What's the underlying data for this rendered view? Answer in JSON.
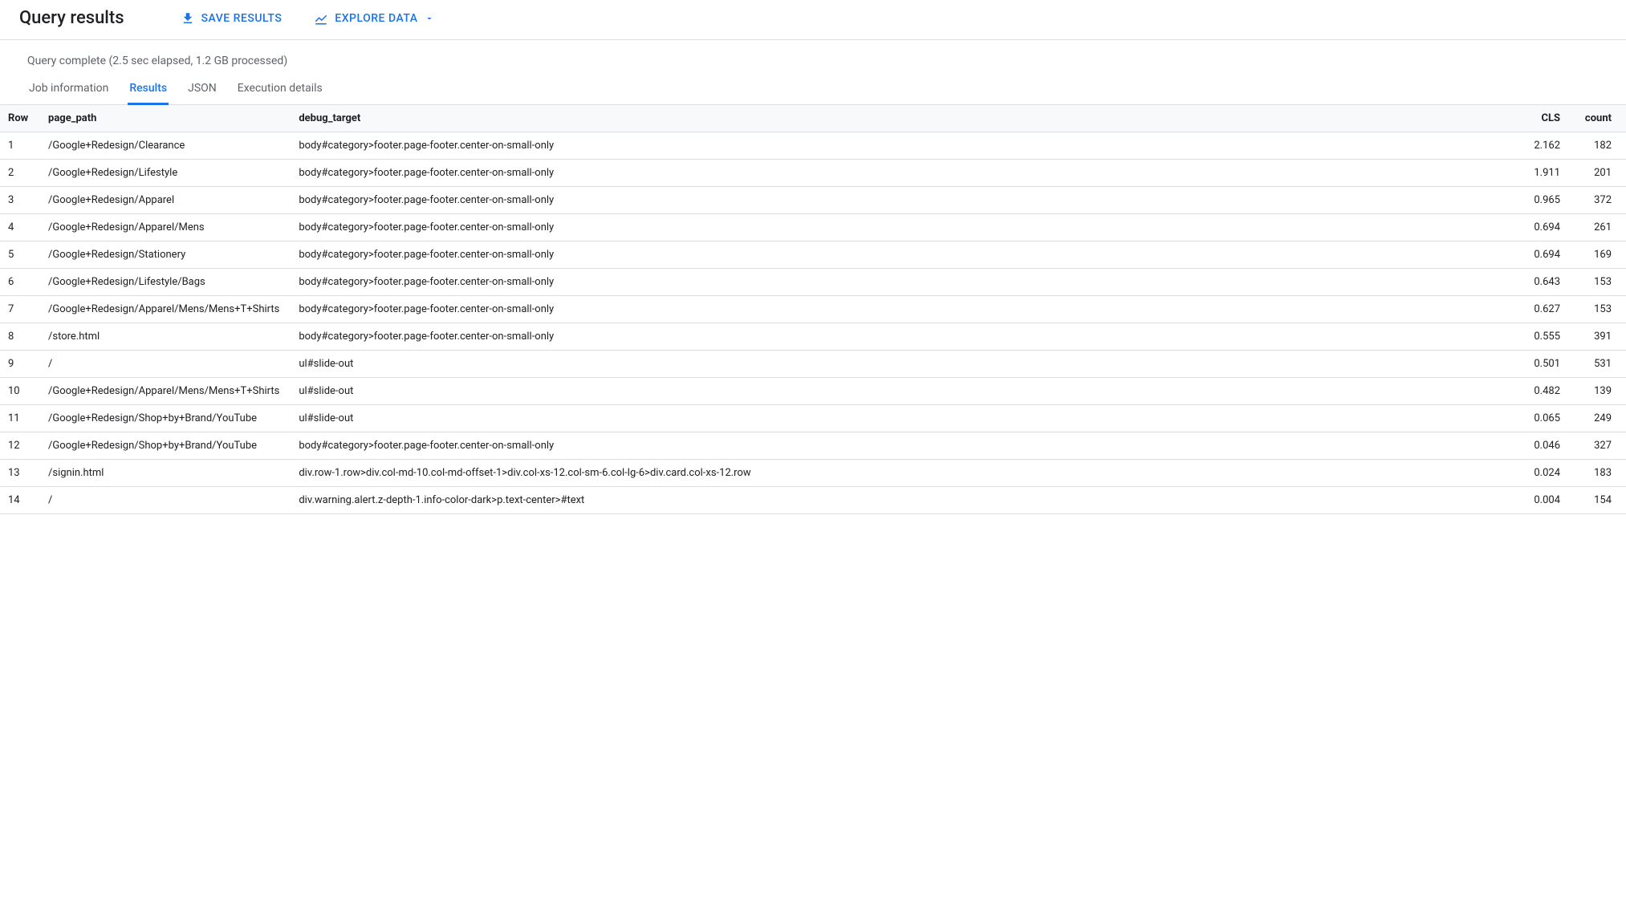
{
  "header": {
    "title": "Query results",
    "save_label": "SAVE RESULTS",
    "explore_label": "EXPLORE DATA"
  },
  "status": "Query complete (2.5 sec elapsed, 1.2 GB processed)",
  "tabs": {
    "job": "Job information",
    "results": "Results",
    "json": "JSON",
    "exec": "Execution details"
  },
  "columns": {
    "row": "Row",
    "page_path": "page_path",
    "debug_target": "debug_target",
    "cls": "CLS",
    "count": "count"
  },
  "rows": [
    {
      "n": "1",
      "page_path": "/Google+Redesign/Clearance",
      "debug_target": "body#category>footer.page-footer.center-on-small-only",
      "cls": "2.162",
      "count": "182"
    },
    {
      "n": "2",
      "page_path": "/Google+Redesign/Lifestyle",
      "debug_target": "body#category>footer.page-footer.center-on-small-only",
      "cls": "1.911",
      "count": "201"
    },
    {
      "n": "3",
      "page_path": "/Google+Redesign/Apparel",
      "debug_target": "body#category>footer.page-footer.center-on-small-only",
      "cls": "0.965",
      "count": "372"
    },
    {
      "n": "4",
      "page_path": "/Google+Redesign/Apparel/Mens",
      "debug_target": "body#category>footer.page-footer.center-on-small-only",
      "cls": "0.694",
      "count": "261"
    },
    {
      "n": "5",
      "page_path": "/Google+Redesign/Stationery",
      "debug_target": "body#category>footer.page-footer.center-on-small-only",
      "cls": "0.694",
      "count": "169"
    },
    {
      "n": "6",
      "page_path": "/Google+Redesign/Lifestyle/Bags",
      "debug_target": "body#category>footer.page-footer.center-on-small-only",
      "cls": "0.643",
      "count": "153"
    },
    {
      "n": "7",
      "page_path": "/Google+Redesign/Apparel/Mens/Mens+T+Shirts",
      "debug_target": "body#category>footer.page-footer.center-on-small-only",
      "cls": "0.627",
      "count": "153"
    },
    {
      "n": "8",
      "page_path": "/store.html",
      "debug_target": "body#category>footer.page-footer.center-on-small-only",
      "cls": "0.555",
      "count": "391"
    },
    {
      "n": "9",
      "page_path": "/",
      "debug_target": "ul#slide-out",
      "cls": "0.501",
      "count": "531"
    },
    {
      "n": "10",
      "page_path": "/Google+Redesign/Apparel/Mens/Mens+T+Shirts",
      "debug_target": "ul#slide-out",
      "cls": "0.482",
      "count": "139"
    },
    {
      "n": "11",
      "page_path": "/Google+Redesign/Shop+by+Brand/YouTube",
      "debug_target": "ul#slide-out",
      "cls": "0.065",
      "count": "249"
    },
    {
      "n": "12",
      "page_path": "/Google+Redesign/Shop+by+Brand/YouTube",
      "debug_target": "body#category>footer.page-footer.center-on-small-only",
      "cls": "0.046",
      "count": "327"
    },
    {
      "n": "13",
      "page_path": "/signin.html",
      "debug_target": "div.row-1.row>div.col-md-10.col-md-offset-1>div.col-xs-12.col-sm-6.col-lg-6>div.card.col-xs-12.row",
      "cls": "0.024",
      "count": "183"
    },
    {
      "n": "14",
      "page_path": "/",
      "debug_target": "div.warning.alert.z-depth-1.info-color-dark>p.text-center>#text",
      "cls": "0.004",
      "count": "154"
    }
  ]
}
